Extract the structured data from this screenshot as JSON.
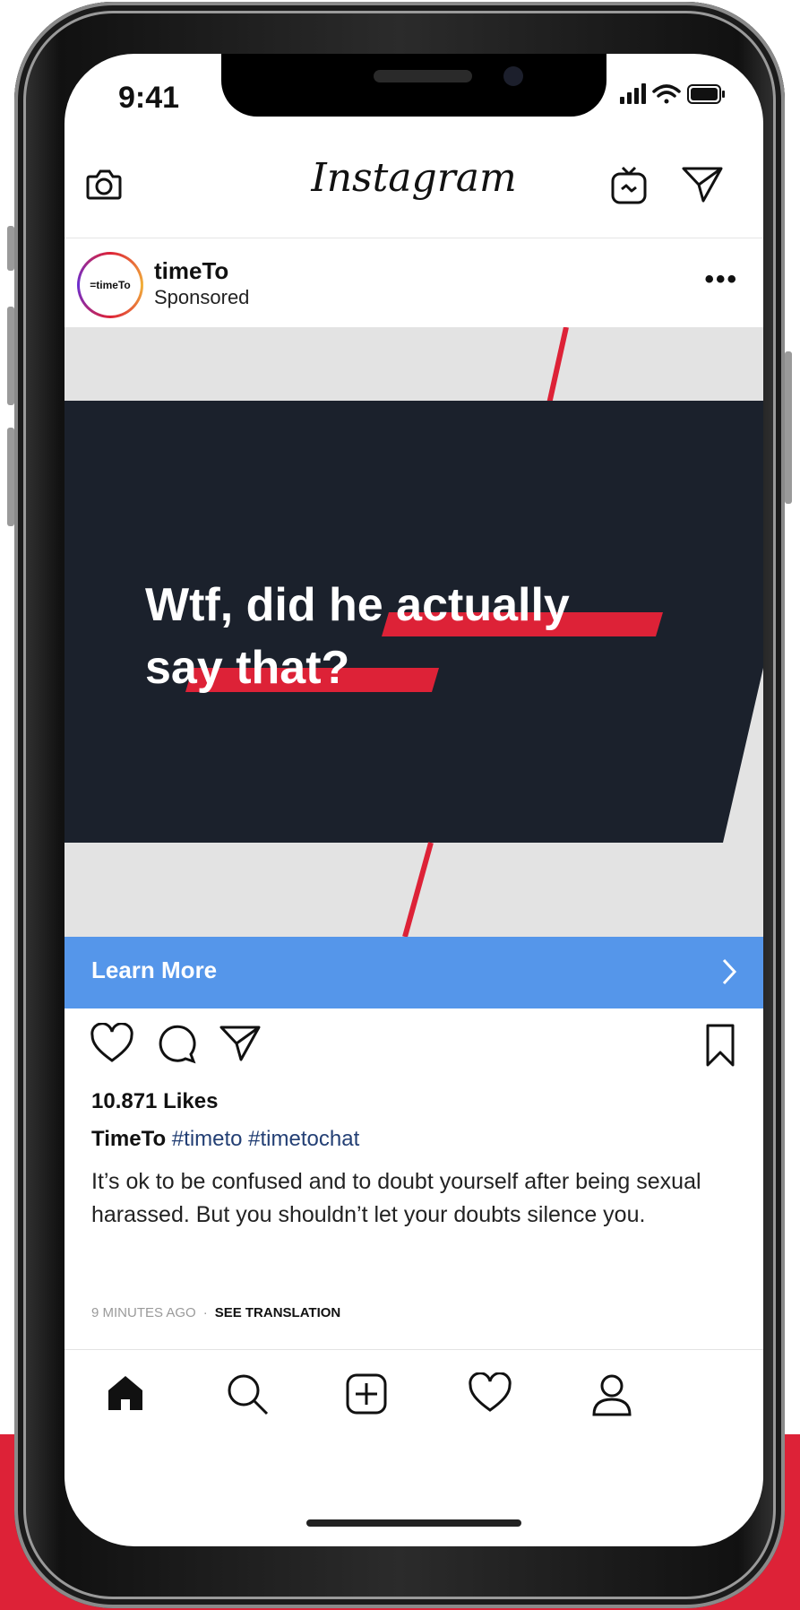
{
  "status_bar": {
    "time": "9:41"
  },
  "header": {
    "logo": "Instagram"
  },
  "post": {
    "avatar_text": "=timeTo",
    "account": "timeTo",
    "subtitle": "Sponsored",
    "more": "•••",
    "ad_text_line1": "Wtf, did he actually",
    "ad_text_line2": "say that?",
    "cta_label": "Learn More",
    "likes": "10.871 Likes",
    "caption_user": "TimeTo",
    "hashtags": "#timeto #timetochat",
    "caption_body": "It’s ok to be confused and to doubt yourself after being sexual harassed. But you shouldn’t let your doubts silence you.",
    "time_ago": "9 MINUTES AGO",
    "separator": "·",
    "see_translation": "SEE TRANSLATION"
  },
  "colors": {
    "accent_red": "#dd2237",
    "ad_dark": "#1b212c",
    "cta_blue": "#5596ea",
    "hashtag_blue": "#233f74"
  },
  "icons": {
    "header": [
      "camera-icon",
      "igtv-icon",
      "direct-message-icon"
    ],
    "actions": [
      "heart-icon",
      "comment-icon",
      "share-icon",
      "bookmark-icon"
    ],
    "tabbar": [
      "home-icon",
      "search-icon",
      "add-post-icon",
      "activity-heart-icon",
      "profile-icon"
    ]
  }
}
